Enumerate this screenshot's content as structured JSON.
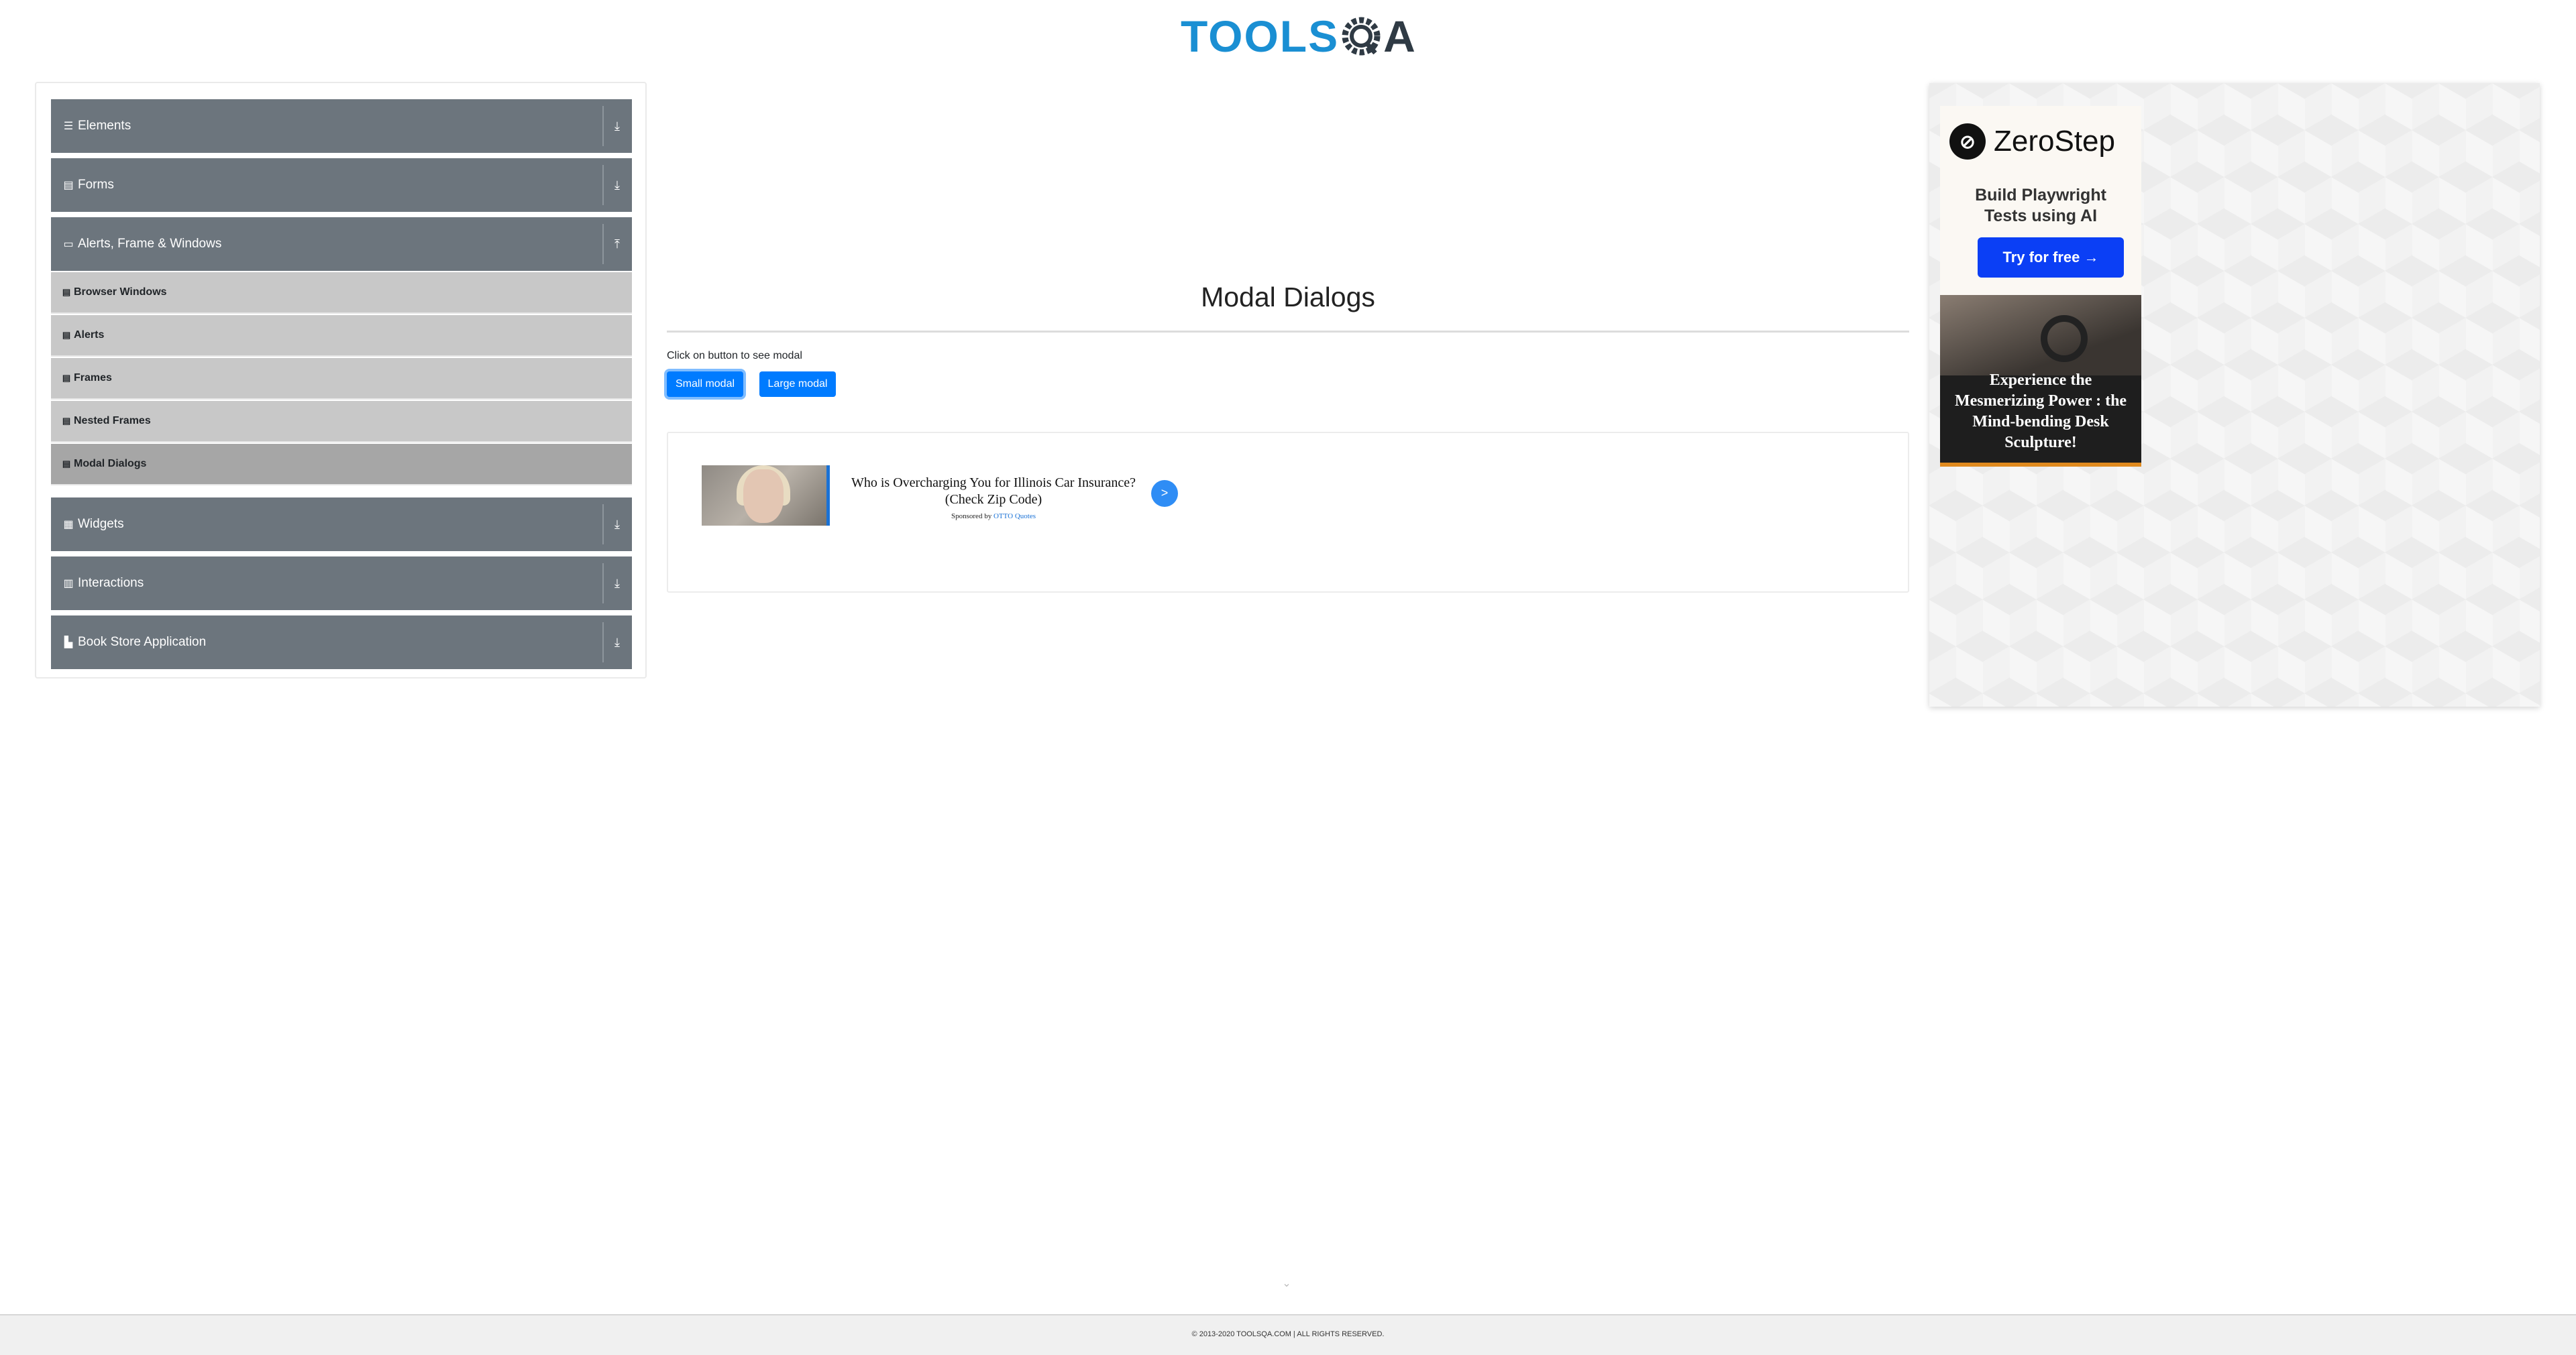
{
  "header": {
    "logo_text_left": "TOOLS",
    "logo_text_right": "A",
    "logo_alt": "TOOLSQA"
  },
  "sidebar": {
    "groups": [
      {
        "label": "Elements",
        "icon": "list-icon"
      },
      {
        "label": "Forms",
        "icon": "form-icon"
      },
      {
        "label": "Alerts, Frame & Windows",
        "icon": "window-icon",
        "expanded": true,
        "items": [
          {
            "label": "Browser Windows"
          },
          {
            "label": "Alerts"
          },
          {
            "label": "Frames"
          },
          {
            "label": "Nested Frames"
          },
          {
            "label": "Modal Dialogs",
            "active": true
          }
        ]
      },
      {
        "label": "Widgets",
        "icon": "grid-icon"
      },
      {
        "label": "Interactions",
        "icon": "interactions-icon"
      },
      {
        "label": "Book Store Application",
        "icon": "book-store-icon"
      }
    ]
  },
  "main": {
    "title": "Modal Dialogs",
    "intro": "Click on button to see modal",
    "small_modal_label": "Small modal",
    "large_modal_label": "Large modal",
    "ad": {
      "headline_line1": "Who is Overcharging You for Illinois Car Insurance?",
      "headline_line2": "(Check Zip Code)",
      "sponsored_prefix": "Sponsored by",
      "sponsor": "OTTO Quotes",
      "go_symbol": ">"
    }
  },
  "right_ad": {
    "zerostep_name": "ZeroStep",
    "tagline_line1": "Build Playwright",
    "tagline_line2": "Tests using AI",
    "cta": "Try for free →",
    "promo_text": "Experience the Mesmerizing Power : the Mind-bending Desk Sculpture!",
    "promo_bar_color": "#e08a1e"
  },
  "footer": {
    "copyright": "© 2013-2020 TOOLSQA.COM | ALL RIGHTS RESERVED."
  },
  "colors": {
    "brand_blue": "#1a8fd3",
    "sidebar_header": "#6c757d",
    "sub_item": "#c8c8c8",
    "sub_item_active": "#a6a6a6",
    "button_primary": "#007bff",
    "cta_blue": "#0b3ff5"
  }
}
